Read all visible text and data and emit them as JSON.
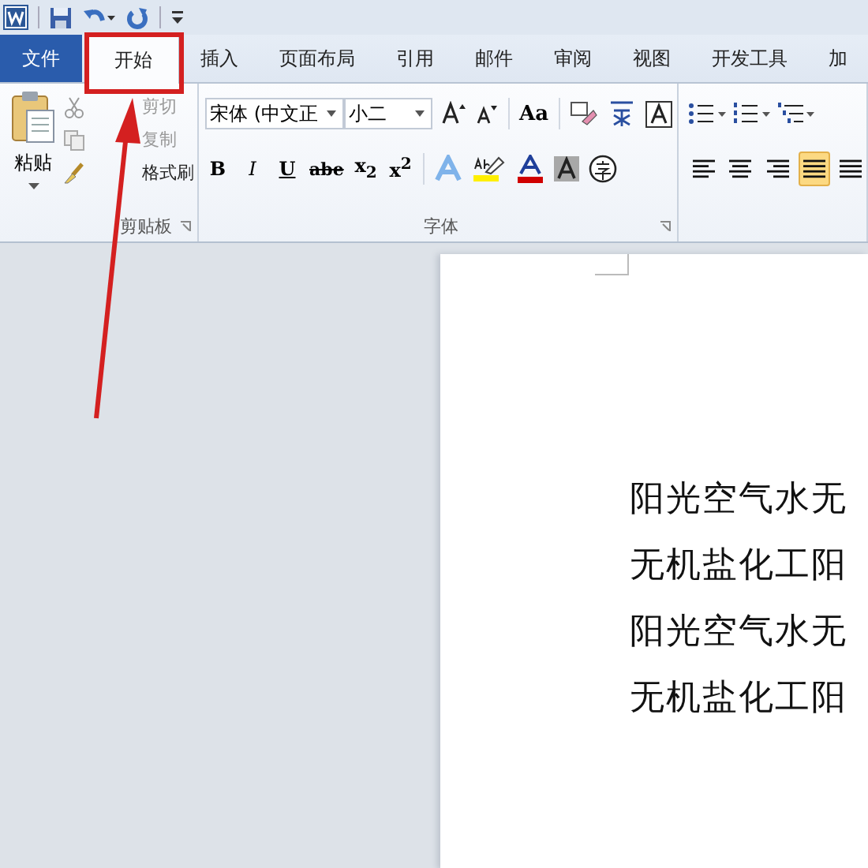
{
  "tabs": [
    {
      "label": "文件",
      "kind": "file",
      "selected": false
    },
    {
      "label": "开始",
      "kind": "tab",
      "selected": true
    },
    {
      "label": "插入",
      "kind": "tab",
      "selected": false
    },
    {
      "label": "页面布局",
      "kind": "tab",
      "selected": false
    },
    {
      "label": "引用",
      "kind": "tab",
      "selected": false
    },
    {
      "label": "邮件",
      "kind": "tab",
      "selected": false
    },
    {
      "label": "审阅",
      "kind": "tab",
      "selected": false
    },
    {
      "label": "视图",
      "kind": "tab",
      "selected": false
    },
    {
      "label": "开发工具",
      "kind": "tab",
      "selected": false
    },
    {
      "label": "加",
      "kind": "tab",
      "selected": false
    }
  ],
  "clipboard": {
    "paste": "粘贴",
    "label": "剪贴板",
    "items": [
      {
        "label": "剪切",
        "kind": "cut",
        "disabled": true
      },
      {
        "label": "复制",
        "kind": "copy",
        "disabled": true
      },
      {
        "label": "格式刷",
        "kind": "brush",
        "disabled": false
      }
    ]
  },
  "font": {
    "name": "宋体 (中文正",
    "size": "小二",
    "label": "字体",
    "change_case": "Aa",
    "formats": [
      "B",
      "I",
      "U",
      "abe",
      "x$_{2}$",
      "x$^{2}$"
    ]
  },
  "paragraph": {
    "alignments": [
      {
        "kind": "left",
        "selected": false
      },
      {
        "kind": "center",
        "selected": false
      },
      {
        "kind": "right",
        "selected": false
      },
      {
        "kind": "justify",
        "selected": true
      },
      {
        "kind": "distributed",
        "selected": false
      }
    ]
  },
  "document": {
    "lines": [
      "阳光空气水无",
      "无机盐化工阳",
      "阳光空气水无",
      "无机盐化工阳"
    ]
  }
}
